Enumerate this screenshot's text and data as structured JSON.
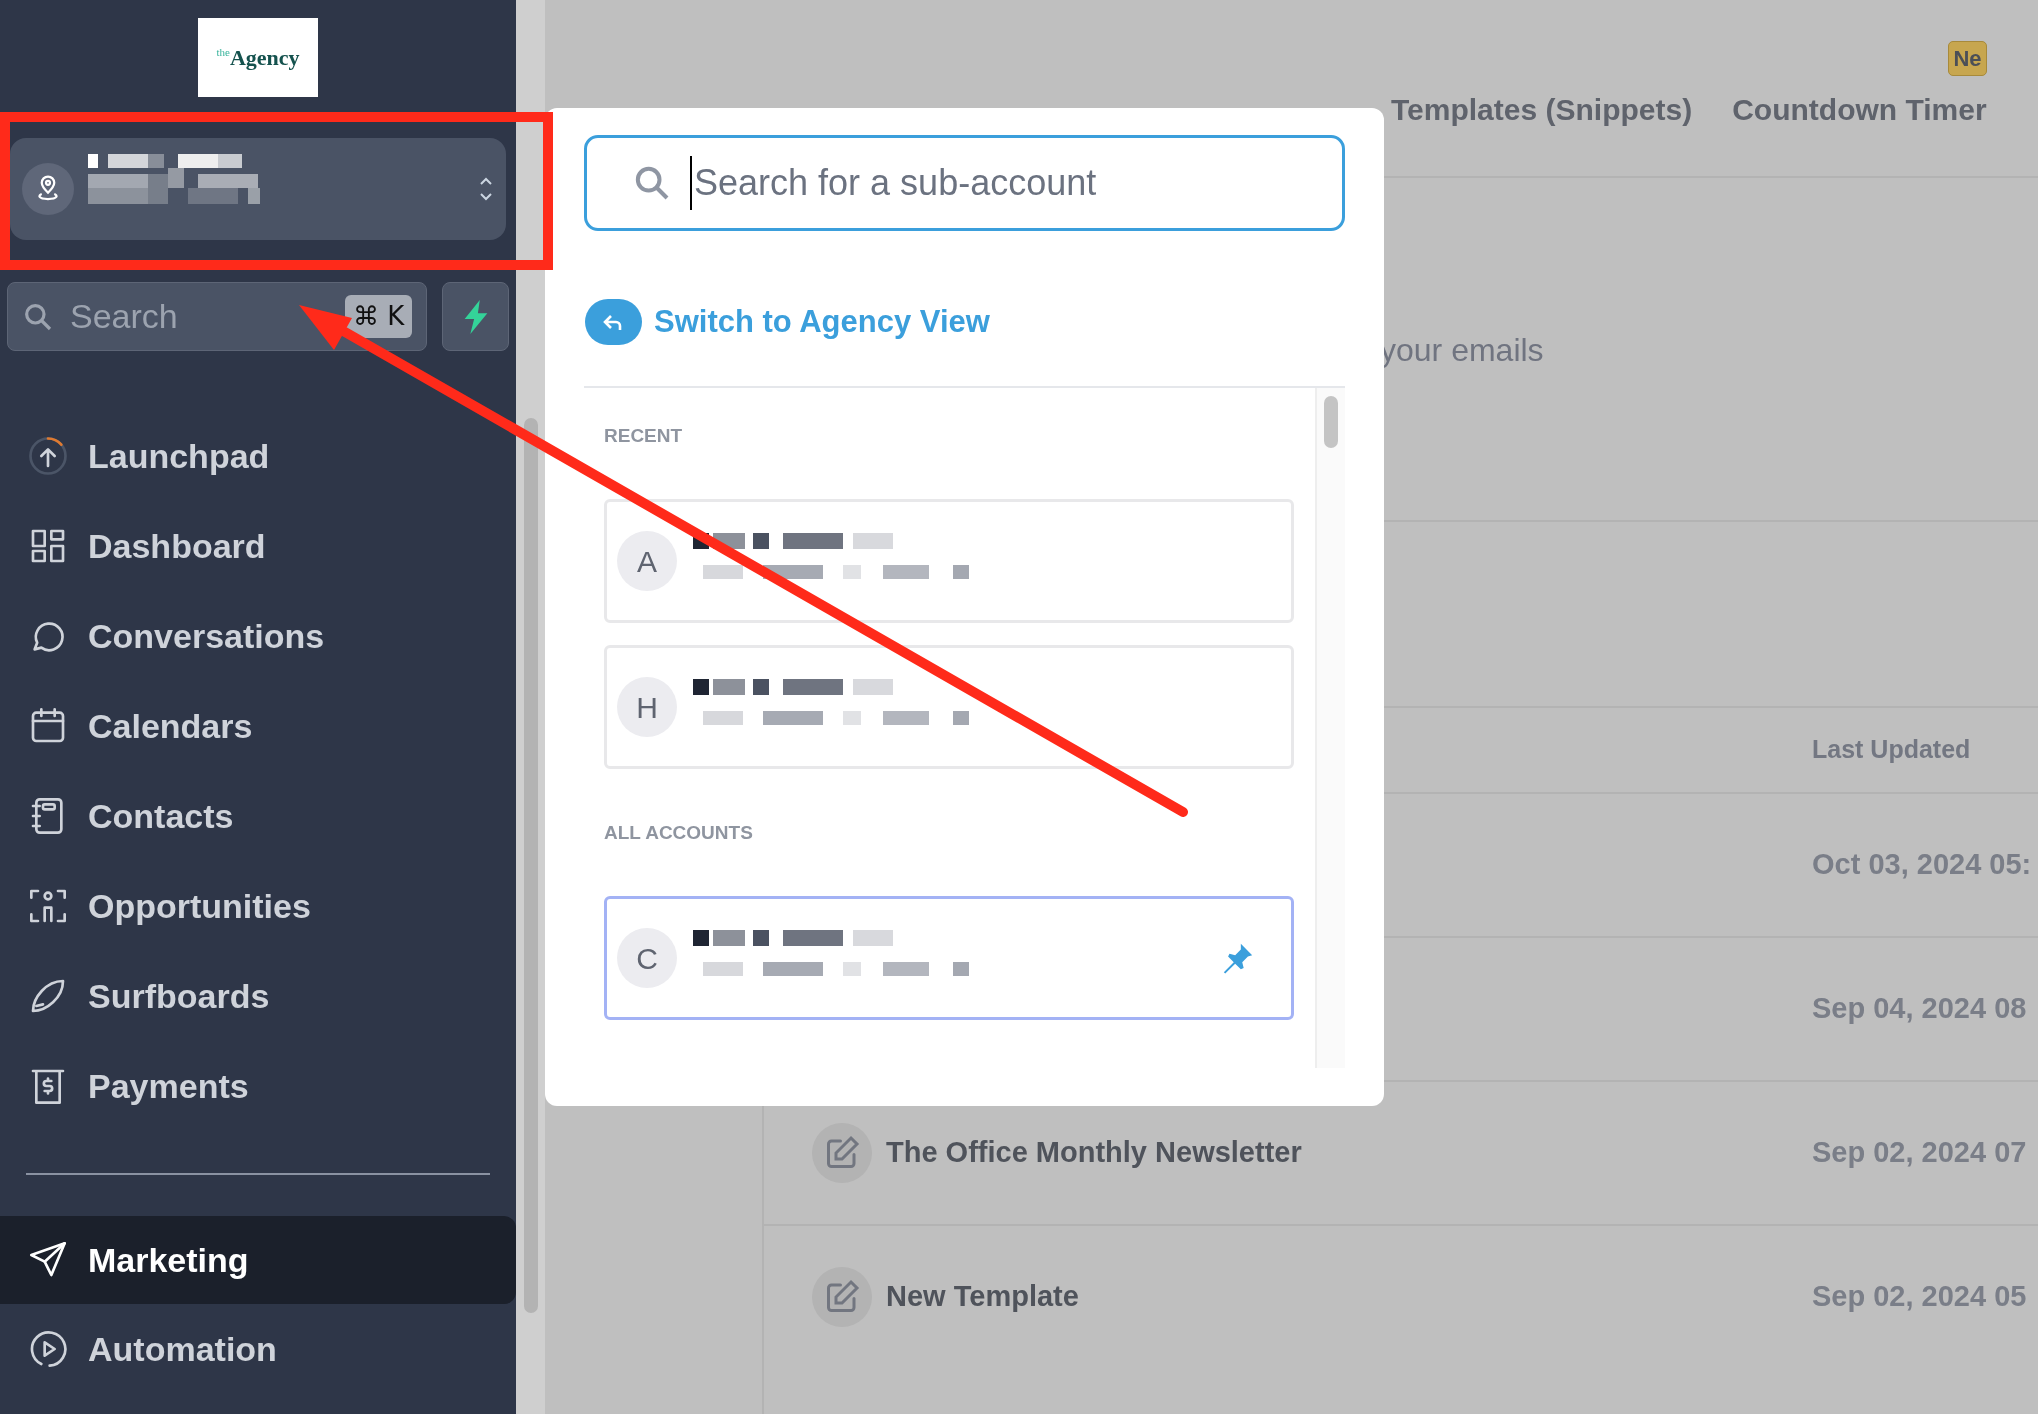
{
  "logo": {
    "prefix": "the",
    "name": "Agency"
  },
  "sidebar": {
    "search": {
      "placeholder": "Search",
      "shortcut": "⌘ K"
    },
    "items": [
      {
        "label": "Launchpad",
        "selected": false,
        "divider_before": false
      },
      {
        "label": "Dashboard",
        "selected": false,
        "divider_before": false
      },
      {
        "label": "Conversations",
        "selected": false,
        "divider_before": false
      },
      {
        "label": "Calendars",
        "selected": false,
        "divider_before": false
      },
      {
        "label": "Contacts",
        "selected": false,
        "divider_before": false
      },
      {
        "label": "Opportunities",
        "selected": false,
        "divider_before": false
      },
      {
        "label": "Surfboards",
        "selected": false,
        "divider_before": false
      },
      {
        "label": "Payments",
        "selected": false,
        "divider_before": false
      },
      {
        "label": "Marketing",
        "selected": true,
        "divider_before": true
      },
      {
        "label": "Automation",
        "selected": false,
        "divider_before": false
      }
    ]
  },
  "main": {
    "tabs": [
      {
        "label": "Templates (Snippets)",
        "selected": false
      },
      {
        "label": "Countdown Timer",
        "selected": false,
        "badge": "Ne"
      }
    ],
    "description": "your emails",
    "table": {
      "columns": [
        "Last Updated"
      ],
      "rows": [
        {
          "updated": "Oct 03, 2024 05:"
        },
        {
          "updated": "Sep 04, 2024 08"
        },
        {
          "name": "The Office Monthly Newsletter",
          "updated": "Sep 02, 2024 07"
        },
        {
          "name": "New Template",
          "updated": "Sep 02, 2024 05"
        }
      ]
    }
  },
  "account_switcher": {
    "search": {
      "placeholder": "Search for a sub-account"
    },
    "switch_link": "Switch to Agency View",
    "sections": [
      {
        "title": "RECENT",
        "accounts": [
          {
            "initial": "A",
            "pinned": false,
            "selected": false
          },
          {
            "initial": "H",
            "pinned": false,
            "selected": false
          }
        ]
      },
      {
        "title": "ALL ACCOUNTS",
        "accounts": [
          {
            "initial": "C",
            "pinned": true,
            "selected": true
          }
        ]
      }
    ]
  }
}
